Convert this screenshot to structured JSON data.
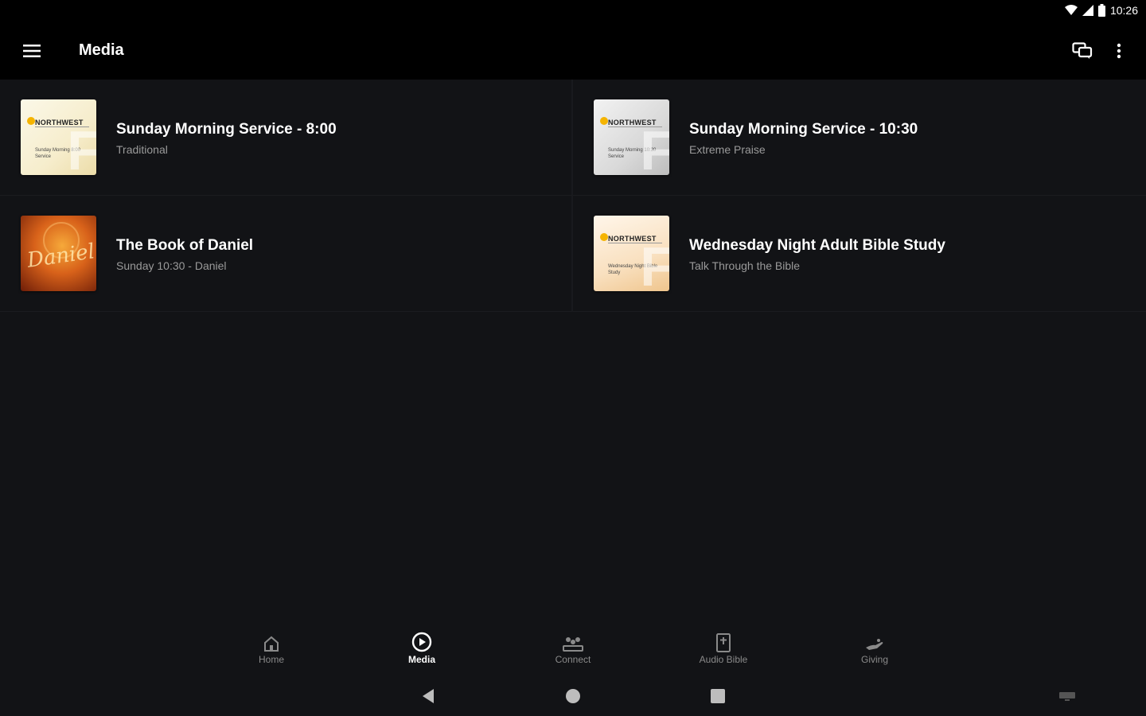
{
  "status": {
    "time": "10:26"
  },
  "appbar": {
    "title": "Media"
  },
  "tiles": [
    {
      "title": "Sunday Morning Service - 8:00",
      "subtitle": "Traditional",
      "thumb_brand": "NORTHWEST",
      "thumb_text": "Sunday Morning 8:00 Service"
    },
    {
      "title": "Sunday Morning Service - 10:30",
      "subtitle": "Extreme Praise",
      "thumb_brand": "NORTHWEST",
      "thumb_text": "Sunday Morning 10:30 Service"
    },
    {
      "title": "The Book of Daniel",
      "subtitle": "Sunday 10:30 - Daniel",
      "thumb_word": "Daniel"
    },
    {
      "title": "Wednesday Night Adult Bible Study",
      "subtitle": "Talk Through the Bible",
      "thumb_brand": "NORTHWEST",
      "thumb_text": "Wednesday Night Bible Study"
    }
  ],
  "bottom_nav": [
    {
      "label": "Home",
      "icon": "home-icon"
    },
    {
      "label": "Media",
      "icon": "play-circle-icon",
      "active": true
    },
    {
      "label": "Connect",
      "icon": "people-icon"
    },
    {
      "label": "Audio Bible",
      "icon": "bible-icon"
    },
    {
      "label": "Giving",
      "icon": "giving-hand-icon"
    }
  ],
  "colors": {
    "background": "#121316",
    "appbar": "#000000",
    "inactive": "#8a8a8a",
    "accent_sun": "#f5b400"
  }
}
